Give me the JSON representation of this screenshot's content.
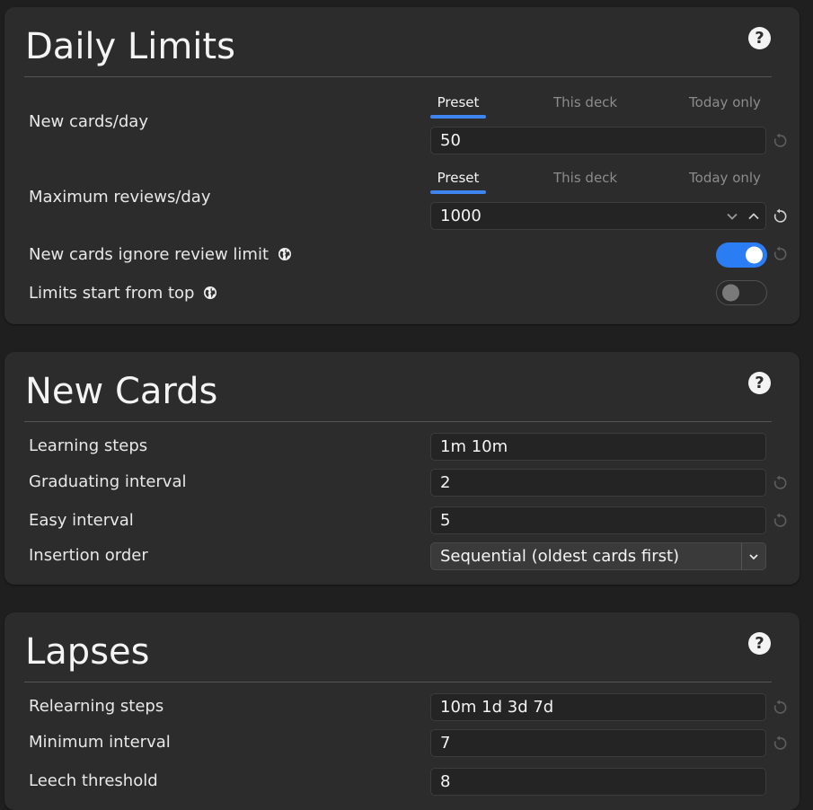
{
  "daily_limits": {
    "title": "Daily Limits",
    "help_icon": "?",
    "tabs": {
      "preset": "Preset",
      "this_deck": "This deck",
      "today_only": "Today only"
    },
    "new_cards_label": "New cards/day",
    "new_cards_value": "50",
    "max_reviews_label": "Maximum reviews/day",
    "max_reviews_value": "1000",
    "ignore_limit_label": "New cards ignore review limit",
    "ignore_limit_on": true,
    "start_top_label": "Limits start from top",
    "start_top_on": false
  },
  "new_cards": {
    "title": "New Cards",
    "help_icon": "?",
    "learning_steps_label": "Learning steps",
    "learning_steps_value": "1m 10m",
    "graduating_label": "Graduating interval",
    "graduating_value": "2",
    "easy_label": "Easy interval",
    "easy_value": "5",
    "insertion_label": "Insertion order",
    "insertion_value": "Sequential (oldest cards first)"
  },
  "lapses": {
    "title": "Lapses",
    "help_icon": "?",
    "relearning_label": "Relearning steps",
    "relearning_value": "10m 1d 3d 7d",
    "min_interval_label": "Minimum interval",
    "min_interval_value": "7",
    "leech_label": "Leech threshold",
    "leech_value": "8"
  },
  "colors": {
    "accent": "#3f85f2",
    "toggle_on": "#2b7df3",
    "card_bg": "#2c2c2c",
    "page_bg": "#1f1f1f"
  },
  "icons": [
    "help-icon",
    "globe-icon",
    "revert-icon",
    "chevron-down-icon",
    "chevron-up-icon"
  ]
}
